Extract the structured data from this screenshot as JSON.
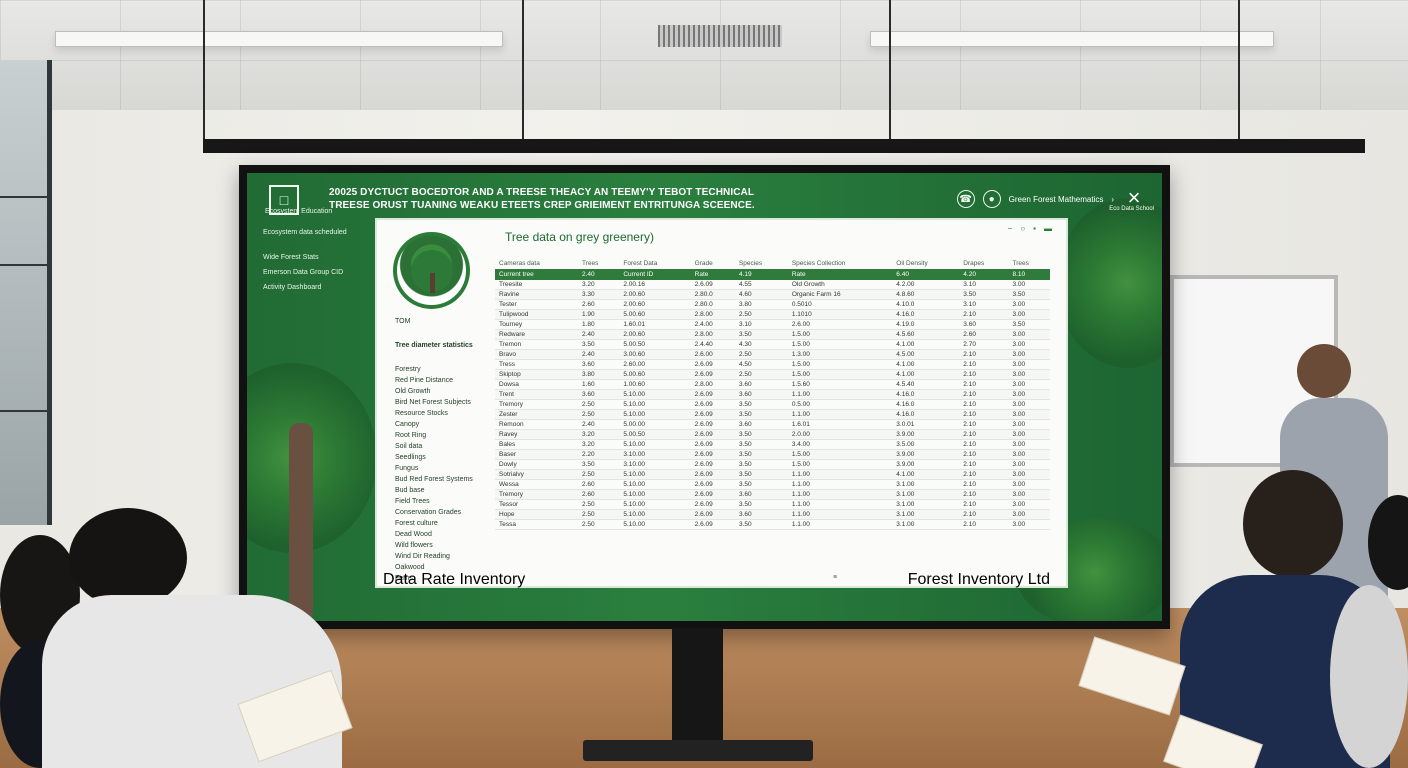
{
  "display": {
    "app": {
      "logo_label": "□",
      "logo_subtext": "Ecosystem\nEducation",
      "title_line_1": "20025 DYCTUCT BOCEDTOR AND A TREESE THEACY AN TEEMY'Y TEBOT TECHNICAL",
      "title_line_2": "TREESE ORUST TUANING WEAKU ETEETS CREP GRIEIMENT ENTRITUNGA SCEENCE.",
      "header_right_label": "Green Forest Mathematics",
      "right_note": "Eco Data\nSchool"
    },
    "sidebar": {
      "top_item": "Ecosystem data scheduled",
      "items": [
        "Wide Forest Stats",
        "Emerson Data Group CID",
        "Activity Dashboard"
      ]
    },
    "main": {
      "panel_title": "Tree data on grey greenery)",
      "panel_tools": [
        "−",
        "○",
        "▪",
        "▬"
      ],
      "left_label_top": "TOM",
      "left_section_title": "Tree diameter statistics",
      "left_items": [
        "Forestry",
        "Red Pine Distance",
        "Old Growth",
        "Bird Net Forest Subjects",
        "Resource Stocks",
        "Canopy",
        "Root Ring",
        "Soil data",
        "Seedlings",
        "Fungus",
        "Bud Red Forest Systems",
        "Bud base",
        "Field Trees",
        "Conservation Grades",
        "Forest culture",
        "Dead Wood",
        "Wild flowers",
        "Wind Dir Reading",
        "Oakwood",
        "Ferns"
      ],
      "table": {
        "headers_1": [
          "Cameras data",
          "Trees",
          "Forest Data",
          "Grade",
          "Species",
          "Species Collection",
          "Oil Density",
          "Drapes",
          "Trees"
        ],
        "headers_2": [
          "Current tree",
          "2.40",
          "Current ID",
          "Rate",
          "4.19",
          "Rate",
          "6.40",
          "4.20",
          "8.10"
        ],
        "rows": [
          [
            "Treesite",
            "3.20",
            "2.00.16",
            "2.6.09",
            "4.55",
            "Old Growth",
            "4.2.00",
            "3.10",
            "3.00"
          ],
          [
            "Ravine",
            "3.30",
            "2.00.60",
            "2.80.0",
            "4.60",
            "Organic Farm 16",
            "4.8.60",
            "3.50",
            "3.50"
          ],
          [
            "Tester",
            "2.60",
            "2.00.60",
            "2.80.0",
            "3.80",
            "0.5010",
            "4.10.0",
            "3.10",
            "3.00"
          ],
          [
            "Tulipwood",
            "1.90",
            "5.00.60",
            "2.8.00",
            "2.50",
            "1.1010",
            "4.16.0",
            "2.10",
            "3.00"
          ],
          [
            "Tourney",
            "1.80",
            "1.60.01",
            "2.4.00",
            "3.10",
            "2.6.00",
            "4.19.0",
            "3.60",
            "3.50"
          ],
          [
            "Redware",
            "2.40",
            "2.00.60",
            "2.8.00",
            "3.50",
            "1.5.00",
            "4.5.60",
            "2.60",
            "3.00"
          ],
          [
            "Tremon",
            "3.50",
            "5.00.50",
            "2.4.40",
            "4.30",
            "1.5.00",
            "4.1.00",
            "2.70",
            "3.00"
          ],
          [
            "Bravo",
            "2.40",
            "3.00.60",
            "2.6.00",
            "2.50",
            "1.3.00",
            "4.5.00",
            "2.10",
            "3.00"
          ],
          [
            "Tress",
            "3.60",
            "2.60.00",
            "2.6.09",
            "4.50",
            "1.5.00",
            "4.1.00",
            "2.10",
            "3.00"
          ],
          [
            "Skiptop",
            "3.80",
            "5.00.60",
            "2.6.09",
            "2.50",
            "1.5.00",
            "4.1.00",
            "2.10",
            "3.00"
          ],
          [
            "Dowsa",
            "1.60",
            "1.00.60",
            "2.8.00",
            "3.60",
            "1.5.60",
            "4.5.40",
            "2.10",
            "3.00"
          ],
          [
            "Trent",
            "3.60",
            "5.10.00",
            "2.6.09",
            "3.60",
            "1.1.00",
            "4.16.0",
            "2.10",
            "3.00"
          ],
          [
            "Tremory",
            "2.50",
            "5.10.00",
            "2.6.09",
            "3.50",
            "0.5.00",
            "4.16.0",
            "2.10",
            "3.00"
          ],
          [
            "Zester",
            "2.50",
            "5.10.00",
            "2.6.09",
            "3.50",
            "1.1.00",
            "4.16.0",
            "2.10",
            "3.00"
          ],
          [
            "Remoon",
            "2.40",
            "5.00.00",
            "2.6.09",
            "3.60",
            "1.6.01",
            "3.0.01",
            "2.10",
            "3.00"
          ],
          [
            "Ravey",
            "3.20",
            "5.00.50",
            "2.6.09",
            "3.50",
            "2.0.00",
            "3.9.00",
            "2.10",
            "3.00"
          ],
          [
            "Bales",
            "3.20",
            "5.10.00",
            "2.6.09",
            "3.50",
            "3.4.00",
            "3.5.00",
            "2.10",
            "3.00"
          ],
          [
            "Baser",
            "2.20",
            "3.10.00",
            "2.6.09",
            "3.50",
            "1.5.00",
            "3.9.00",
            "2.10",
            "3.00"
          ],
          [
            "Dowly",
            "3.50",
            "3.10.00",
            "2.6.09",
            "3.50",
            "1.5.00",
            "3.9.00",
            "2.10",
            "3.00"
          ],
          [
            "Sotrialvy",
            "2.50",
            "5.10.00",
            "2.6.09",
            "3.50",
            "1.1.00",
            "4.1.00",
            "2.10",
            "3.00"
          ],
          [
            "Wessa",
            "2.60",
            "5.10.00",
            "2.6.09",
            "3.50",
            "1.1.00",
            "3.1.00",
            "2.10",
            "3.00"
          ],
          [
            "Tremory",
            "2.60",
            "5.10.00",
            "2.6.09",
            "3.60",
            "1.1.00",
            "3.1.00",
            "2.10",
            "3.00"
          ],
          [
            "Tessor",
            "2.50",
            "5.10.00",
            "2.6.09",
            "3.50",
            "1.1.00",
            "3.1.00",
            "2.10",
            "3.00"
          ],
          [
            "Hope",
            "2.50",
            "5.10.00",
            "2.6.09",
            "3.60",
            "1.1.00",
            "3.1.00",
            "2.10",
            "3.00"
          ],
          [
            "Tessa",
            "2.50",
            "5.10.00",
            "2.6.09",
            "3.50",
            "1.1.00",
            "3.1.00",
            "2.10",
            "3.00"
          ]
        ]
      },
      "footer_center": "≡"
    },
    "footer": {
      "left_label": "Data Rate Inventory",
      "right_label": "Forest Inventory Ltd"
    }
  },
  "colors": {
    "forest_green": "#216b35",
    "table_header_green": "#2f7b3b",
    "panel_background": "#fbfbfa"
  }
}
